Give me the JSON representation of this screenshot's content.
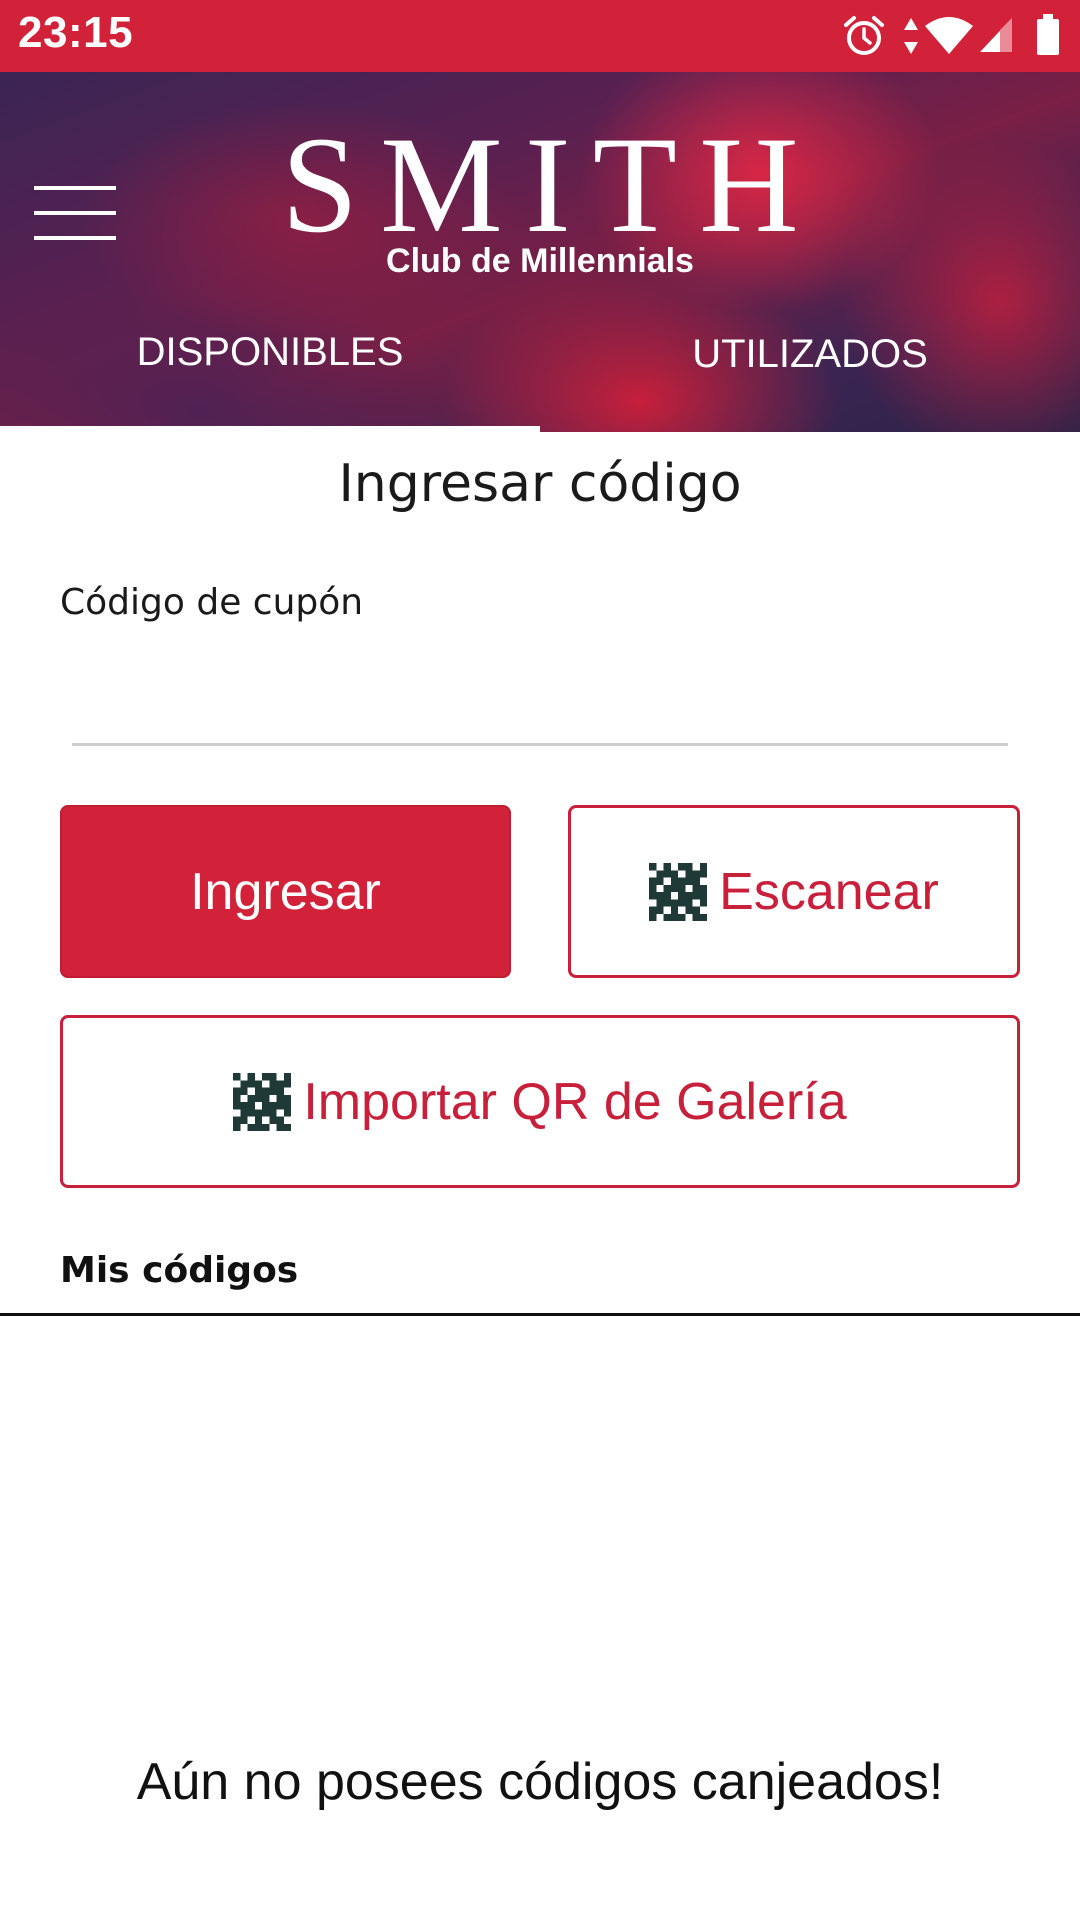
{
  "status_bar": {
    "time": "23:15",
    "icons": [
      "alarm-icon",
      "data-arrows-icon",
      "wifi-icon",
      "signal-icon",
      "battery-icon"
    ],
    "background": "#d2223a"
  },
  "header": {
    "brand_title": "SMITH",
    "brand_subtitle": "Club de Millennials",
    "menu_icon": "hamburger-menu-icon",
    "tabs": [
      {
        "label": "DISPONIBLES",
        "selected": true
      },
      {
        "label": "UTILIZADOS",
        "selected": false
      }
    ]
  },
  "main": {
    "title": "Ingresar código",
    "coupon_field": {
      "label": "Código de cupón",
      "value": "",
      "placeholder": ""
    },
    "buttons": {
      "submit": "Ingresar",
      "scan": "Escanear",
      "import": "Importar QR de Galería"
    },
    "my_codes": {
      "title": "Mis códigos",
      "empty_message": "Aún no posees códigos canjeados!"
    }
  },
  "colors": {
    "accent": "#d2223a",
    "outline": "#c8203a",
    "text": "#1a1a1a"
  }
}
